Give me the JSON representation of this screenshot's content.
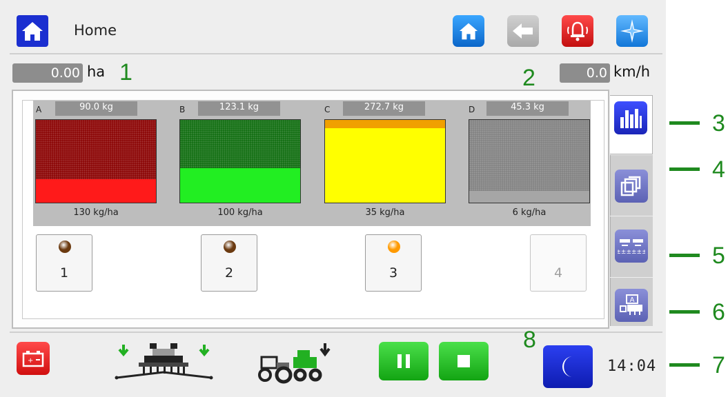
{
  "header": {
    "title": "Home",
    "icons": [
      "home-icon",
      "back-icon",
      "alarm-bell-icon",
      "compass-icon"
    ]
  },
  "readouts": {
    "area_value": "0.00",
    "area_unit": "ha",
    "speed_value": "0.0",
    "speed_unit": "km/h"
  },
  "tanks": [
    {
      "letter": "A",
      "weight": "90.0 kg",
      "rate": "130 kg/ha",
      "fill_level": 0.28,
      "color": "#ff1a1a",
      "empty_color": "#8a0000"
    },
    {
      "letter": "B",
      "weight": "123.1 kg",
      "rate": "100 kg/ha",
      "fill_level": 0.42,
      "color": "#22ee22",
      "empty_color": "#0d6b0d"
    },
    {
      "letter": "C",
      "weight": "272.7 kg",
      "rate": "35 kg/ha",
      "fill_level": 0.9,
      "color": "#ffff00",
      "empty_color": "#f0a000"
    },
    {
      "letter": "D",
      "weight": "45.3 kg",
      "rate": "6 kg/ha",
      "fill_level": 0.14,
      "color": "#a6a6a6",
      "empty_color": "#808080"
    }
  ],
  "sections": [
    {
      "label": "1",
      "state": "active",
      "dot_color": "#6b3a10"
    },
    {
      "label": "2",
      "state": "active",
      "dot_color": "#6b3a10"
    },
    {
      "label": "3",
      "state": "highlight",
      "dot_color": "#ff9a00"
    },
    {
      "label": "4",
      "state": "disabled",
      "dot_color": ""
    }
  ],
  "side_tabs": [
    "bar-chart-icon",
    "copy-pages-icon",
    "seeder-rows-icon",
    "machine-config-icon"
  ],
  "bottom": {
    "icons": [
      "battery-icon",
      "seeder-icon",
      "tractor-hopper-icon",
      "pause-icon",
      "stop-icon",
      "night-mode-icon"
    ],
    "clock": "14:04"
  },
  "annotations": [
    "1",
    "2",
    "3",
    "4",
    "5",
    "6",
    "7",
    "8"
  ],
  "colors": {
    "blue_button": "#1b2fd0",
    "green_button": "#22c322",
    "red_button": "#e01616",
    "annotation_green": "#1f8a1f"
  }
}
